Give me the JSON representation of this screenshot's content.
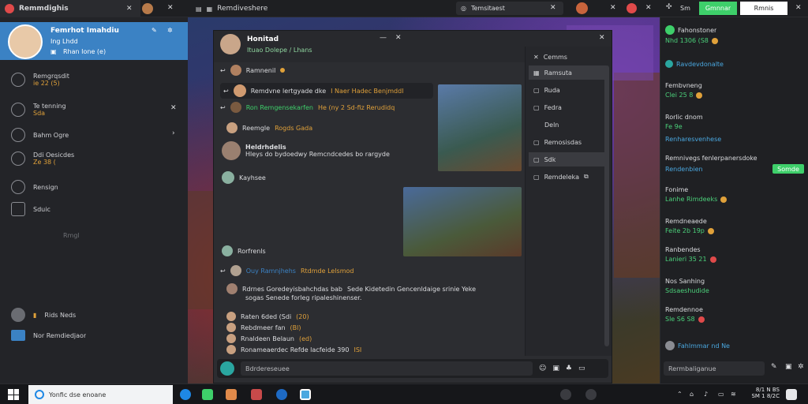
{
  "topbar": {
    "app_title": "Remmdighis",
    "tab_title": "Remdiveshere",
    "search_text": "Temsitaest",
    "btn_green": "Gmnnar",
    "btn_white": "Rmnis",
    "ind_label": "Sm"
  },
  "sidebar": {
    "profile_name": "Femrhot Imahdiu",
    "profile_sub1": "Ing Lhdd",
    "profile_status": "Rhan Ione (e)",
    "items": [
      {
        "label": "Remgrqsdit",
        "sub": "ie 22 (5)"
      },
      {
        "label": "Te tenning",
        "sub": "Sda"
      },
      {
        "label": "Bahm Ogre",
        "sub": ""
      },
      {
        "label": "Ddi Oesicdes",
        "sub": "Ze 38 ("
      },
      {
        "label": "Rensign",
        "sub": ""
      },
      {
        "label": "Sduic",
        "sub": ""
      },
      {
        "label": "Rmgl",
        "sub": ""
      }
    ],
    "footer1": "Rids Neds",
    "footer2": "Nor Remdiedjaor"
  },
  "chat": {
    "header_name": "Honitad",
    "header_sub": "Ituao Dolepe / Lhans",
    "messages": [
      {
        "name": "Ramnenil",
        "text": ""
      },
      {
        "name": "Remdvne lertgyade dke",
        "text": "I Naer Hadec Benjmddl"
      },
      {
        "name": "Ron Remgensekarfen",
        "text": "He (ny 2 Sd-fiz Rerudidq"
      },
      {
        "name": "Reemgle",
        "text": "Rogds Gada"
      },
      {
        "name": "Heldrhdelis",
        "text": "Hleys do bydoedwy Remcndcedes bo rargyde"
      },
      {
        "name": "Kayhsee",
        "text": ""
      },
      {
        "name": "Rorfrenls",
        "text": ""
      },
      {
        "name": "Ouy Ramnjhehs",
        "text": "Rtdmde Lelsmod"
      },
      {
        "name": "Rdrnes Goredeyisbahchdas bab",
        "text": "Sede Kidetedin Gencenldaige srinie Yeke"
      },
      {
        "name": "sogas Senede forleg ripaleshinenser.",
        "text": ""
      },
      {
        "name": "Raten 6ded (Sdi",
        "text": "(20)"
      },
      {
        "name": "Rebdmeer fan",
        "text": "(Bl)"
      },
      {
        "name": "Rnaldeen Belaun",
        "text": "(ed)"
      },
      {
        "name": "Ronameaerdec Refde lacfeide 390",
        "text": "ISI"
      }
    ],
    "input_placeholder": "Bdrdereseuee"
  },
  "members": {
    "title": "Cemms",
    "items": [
      "Ramsuta",
      "Ruda",
      "Fedra",
      "Deln",
      "Remosisdas",
      "Sdk",
      "Remdeleka"
    ]
  },
  "right_panel": {
    "rows": [
      {
        "title": "Fahonstoner",
        "sub": "Nhd 1306 (S8"
      },
      {
        "title": "Ravdevdonalte",
        "sub": ""
      },
      {
        "title": "Fembvneng",
        "sub": "Clei 25 8"
      },
      {
        "title": "Rorlic dnom",
        "sub": "Fe 9e"
      },
      {
        "title": "Renharesvenhese",
        "sub": ""
      },
      {
        "title": "Remnivegs fenlerpanersdoke",
        "sub": "Rendenbien",
        "btn": "Somde"
      },
      {
        "title": "Fonime",
        "sub": "Lanhe Rimdeeks"
      },
      {
        "title": "Remdneaede",
        "sub": "Feite 2b 19p"
      },
      {
        "title": "Ranbendes",
        "sub": "Lanieri 35 21"
      },
      {
        "title": "Nos Sanhing",
        "sub": "Sdsaeshudide"
      },
      {
        "title": "Remdennoe",
        "sub": "Sle S6 S8"
      },
      {
        "title": "Fahlmmar nd Ne",
        "sub": ""
      }
    ],
    "search_placeholder": "Rermbaliganue"
  },
  "taskbar": {
    "search_placeholder": "Yonfic dse enoane",
    "time": "8/1 N BS",
    "date": "SM 1 8/2C"
  },
  "colors": {
    "accent_blue": "#3b82c4",
    "green": "#3ecf6a",
    "orange": "#e0a13a"
  }
}
